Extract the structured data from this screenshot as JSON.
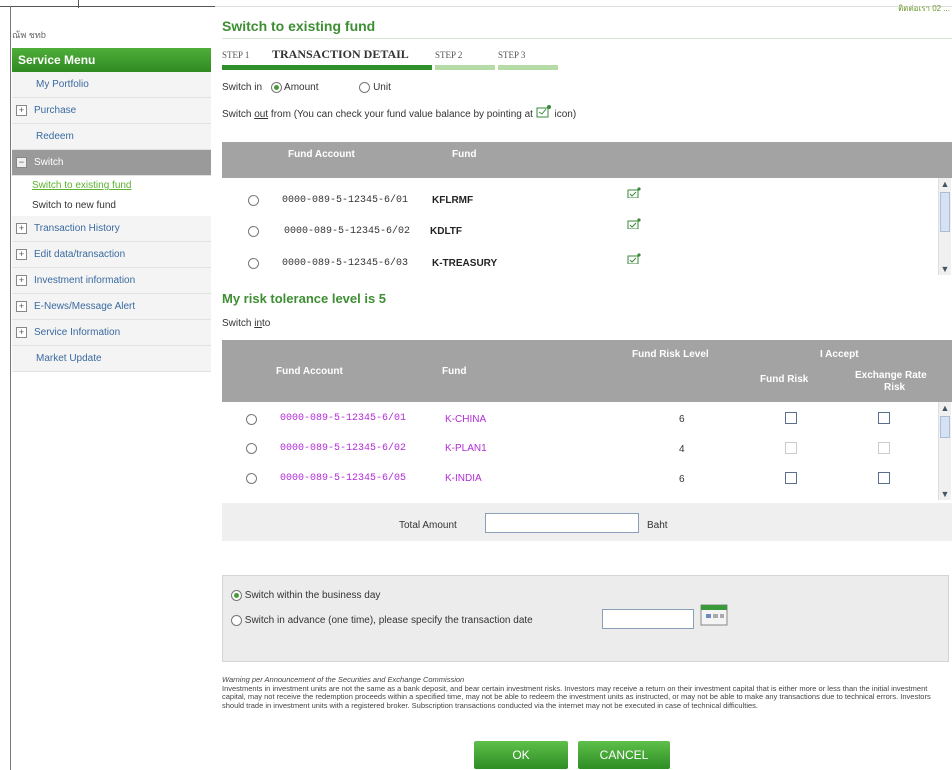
{
  "user": {
    "name": "ณ้พ ชทb"
  },
  "top_link": "ติดต่อเรา 02 ...",
  "sidebar": {
    "header": "Service Menu",
    "items": [
      {
        "label": "My Portfolio",
        "icon": ""
      },
      {
        "label": "Purchase",
        "icon": "plus"
      },
      {
        "label": "Redeem",
        "icon": ""
      },
      {
        "label": "Switch",
        "icon": "minus"
      }
    ],
    "switch_sub": [
      "Switch to existing fund",
      "Switch to new fund"
    ],
    "items_after": [
      {
        "label": "Transaction History",
        "icon": "plus"
      },
      {
        "label": "Edit data/transaction",
        "icon": "plus"
      },
      {
        "label": "Investment information",
        "icon": "plus"
      },
      {
        "label": "E-News/Message Alert",
        "icon": "plus"
      },
      {
        "label": "Service Information",
        "icon": "plus"
      },
      {
        "label": "Market Update",
        "icon": ""
      }
    ]
  },
  "page": {
    "title": "Switch to existing fund",
    "steps": [
      {
        "num": "STEP 1",
        "label": "TRANSACTION DETAIL"
      },
      {
        "num": "STEP 2",
        "label": ""
      },
      {
        "num": "STEP 3",
        "label": ""
      }
    ],
    "switch_in_label": "Switch in",
    "switch_in_options": [
      "Amount",
      "Unit"
    ],
    "switch_out_text_a": "Switch",
    "switch_out_text_b": "out",
    "switch_out_text_c": "from (You can check your fund value balance by pointing at",
    "switch_out_text_d": "icon)"
  },
  "out_table": {
    "headers": [
      "Fund Account",
      "Fund"
    ],
    "rows": [
      {
        "account": "0000-089-5-12345-6/01",
        "fund": "KFLRMF"
      },
      {
        "account": "0000-089-5-12345-6/02",
        "fund": "KDLTF"
      },
      {
        "account": "0000-089-5-12345-6/03",
        "fund": "K-TREASURY"
      }
    ]
  },
  "risk": {
    "text": "My risk tolerance level is 5",
    "switch_in_a": "Switch",
    "switch_in_b": "in",
    "switch_in_c": "to"
  },
  "in_table": {
    "headers": {
      "account": "Fund Account",
      "fund": "Fund",
      "risk_level": "Fund Risk Level",
      "accept": "I Accept",
      "fund_risk": "Fund Risk",
      "fx_risk_1": "Exchange Rate",
      "fx_risk_2": "Risk"
    },
    "rows": [
      {
        "account": "0000-089-5-12345-6/01",
        "fund": "K-CHINA",
        "level": "6"
      },
      {
        "account": "0000-089-5-12345-6/02",
        "fund": "K-PLAN1",
        "level": "4"
      },
      {
        "account": "0000-089-5-12345-6/05",
        "fund": "K-INDIA",
        "level": "6"
      }
    ]
  },
  "total": {
    "label": "Total Amount",
    "value": "",
    "unit": "Baht"
  },
  "options": {
    "within_day": "Switch within the business day",
    "in_advance": "Switch in advance (one time), please specify the transaction date",
    "date_value": ""
  },
  "warning": {
    "title": "Warning per Announcement of the Securities and Exchange Commission",
    "body": "Investments in investment units are not the same as a bank deposit, and bear certain investment risks. Investors may receive a return on their investment capital that is either more or less than the initial investment capital, may not receive the redemption proceeds within a specified time, may not be able to redeem the investment units as instructed, or may not be able to make any transactions due to technical errors. Investors should trade in investment units with a registered broker. Subscription transactions conducted via the internet may not be executed in case of technical difficulties."
  },
  "buttons": {
    "ok": "OK",
    "cancel": "CANCEL"
  },
  "colors": {
    "brand_green": "#3e8e33",
    "header_grey": "#a3a3a3",
    "account_purple": "#b22bd6"
  }
}
